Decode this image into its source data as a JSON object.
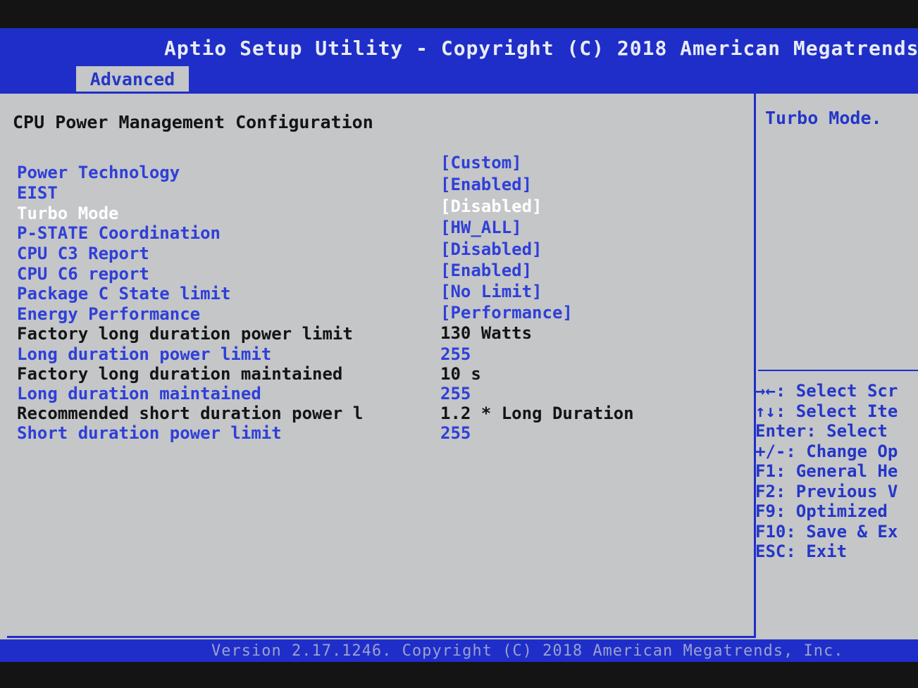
{
  "header": {
    "title": "Aptio Setup Utility - Copyright (C) 2018 American Megatrends,"
  },
  "tabs": [
    {
      "label": "Advanced",
      "active": true
    }
  ],
  "main": {
    "section_title": "CPU Power Management Configuration",
    "rows": [
      {
        "label": "Power Technology",
        "value": "[Custom]",
        "selectable": true
      },
      {
        "label": "EIST",
        "value": "[Enabled]",
        "selectable": true
      },
      {
        "label": "Turbo Mode",
        "value": "[Disabled]",
        "selectable": true,
        "active": true
      },
      {
        "label": "P-STATE Coordination",
        "value": "[HW_ALL]",
        "selectable": true
      },
      {
        "label": "CPU C3 Report",
        "value": "[Disabled]",
        "selectable": true
      },
      {
        "label": "CPU C6 report",
        "value": "[Enabled]",
        "selectable": true
      },
      {
        "label": "Package C State limit",
        "value": "[No Limit]",
        "selectable": true
      },
      {
        "label": "Energy Performance",
        "value": "[Performance]",
        "selectable": true
      },
      {
        "label": "Factory long duration power limit",
        "value": "130 Watts",
        "selectable": false
      },
      {
        "label": "Long duration power limit",
        "value": "255",
        "selectable": true
      },
      {
        "label": "Factory long duration maintained",
        "value": "10 s",
        "selectable": false
      },
      {
        "label": "Long duration maintained",
        "value": "255",
        "selectable": true
      },
      {
        "label": "Recommended short duration power l",
        "value": "1.2 * Long Duration",
        "selectable": false
      },
      {
        "label": "Short duration power limit",
        "value": "255",
        "selectable": true
      }
    ]
  },
  "help": {
    "title": "Turbo Mode.",
    "keys": [
      "→←: Select Scr",
      "↑↓: Select Ite",
      "Enter: Select",
      "+/-: Change Op",
      "F1: General He",
      "F2: Previous V",
      "F9: Optimized ",
      "F10: Save & Ex",
      "ESC: Exit"
    ]
  },
  "footer": {
    "text": "Version 2.17.1246. Copyright (C) 2018 American Megatrends, Inc."
  },
  "colors": {
    "blue": "#1f2ec8",
    "panel": "#c4c6c8",
    "option": "#2f3fd8",
    "selected": "#ffffff"
  }
}
